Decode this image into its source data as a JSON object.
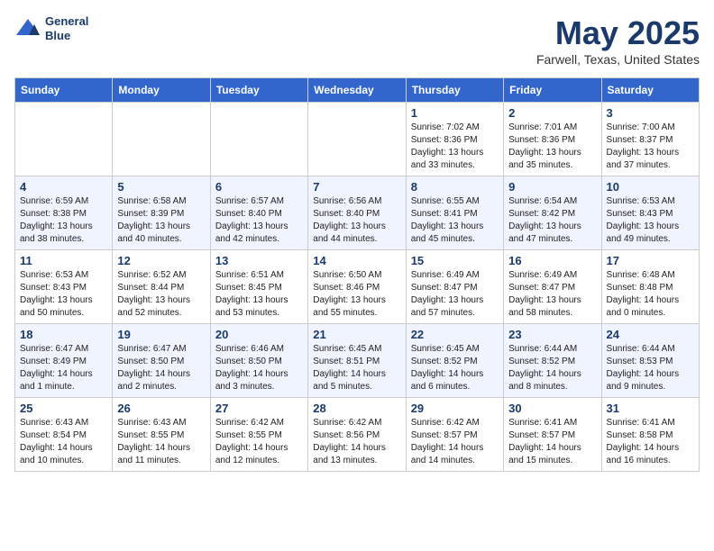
{
  "header": {
    "logo_line1": "General",
    "logo_line2": "Blue",
    "month": "May 2025",
    "location": "Farwell, Texas, United States"
  },
  "weekdays": [
    "Sunday",
    "Monday",
    "Tuesday",
    "Wednesday",
    "Thursday",
    "Friday",
    "Saturday"
  ],
  "weeks": [
    [
      {
        "day": "",
        "info": ""
      },
      {
        "day": "",
        "info": ""
      },
      {
        "day": "",
        "info": ""
      },
      {
        "day": "",
        "info": ""
      },
      {
        "day": "1",
        "info": "Sunrise: 7:02 AM\nSunset: 8:36 PM\nDaylight: 13 hours\nand 33 minutes."
      },
      {
        "day": "2",
        "info": "Sunrise: 7:01 AM\nSunset: 8:36 PM\nDaylight: 13 hours\nand 35 minutes."
      },
      {
        "day": "3",
        "info": "Sunrise: 7:00 AM\nSunset: 8:37 PM\nDaylight: 13 hours\nand 37 minutes."
      }
    ],
    [
      {
        "day": "4",
        "info": "Sunrise: 6:59 AM\nSunset: 8:38 PM\nDaylight: 13 hours\nand 38 minutes."
      },
      {
        "day": "5",
        "info": "Sunrise: 6:58 AM\nSunset: 8:39 PM\nDaylight: 13 hours\nand 40 minutes."
      },
      {
        "day": "6",
        "info": "Sunrise: 6:57 AM\nSunset: 8:40 PM\nDaylight: 13 hours\nand 42 minutes."
      },
      {
        "day": "7",
        "info": "Sunrise: 6:56 AM\nSunset: 8:40 PM\nDaylight: 13 hours\nand 44 minutes."
      },
      {
        "day": "8",
        "info": "Sunrise: 6:55 AM\nSunset: 8:41 PM\nDaylight: 13 hours\nand 45 minutes."
      },
      {
        "day": "9",
        "info": "Sunrise: 6:54 AM\nSunset: 8:42 PM\nDaylight: 13 hours\nand 47 minutes."
      },
      {
        "day": "10",
        "info": "Sunrise: 6:53 AM\nSunset: 8:43 PM\nDaylight: 13 hours\nand 49 minutes."
      }
    ],
    [
      {
        "day": "11",
        "info": "Sunrise: 6:53 AM\nSunset: 8:43 PM\nDaylight: 13 hours\nand 50 minutes."
      },
      {
        "day": "12",
        "info": "Sunrise: 6:52 AM\nSunset: 8:44 PM\nDaylight: 13 hours\nand 52 minutes."
      },
      {
        "day": "13",
        "info": "Sunrise: 6:51 AM\nSunset: 8:45 PM\nDaylight: 13 hours\nand 53 minutes."
      },
      {
        "day": "14",
        "info": "Sunrise: 6:50 AM\nSunset: 8:46 PM\nDaylight: 13 hours\nand 55 minutes."
      },
      {
        "day": "15",
        "info": "Sunrise: 6:49 AM\nSunset: 8:47 PM\nDaylight: 13 hours\nand 57 minutes."
      },
      {
        "day": "16",
        "info": "Sunrise: 6:49 AM\nSunset: 8:47 PM\nDaylight: 13 hours\nand 58 minutes."
      },
      {
        "day": "17",
        "info": "Sunrise: 6:48 AM\nSunset: 8:48 PM\nDaylight: 14 hours\nand 0 minutes."
      }
    ],
    [
      {
        "day": "18",
        "info": "Sunrise: 6:47 AM\nSunset: 8:49 PM\nDaylight: 14 hours\nand 1 minute."
      },
      {
        "day": "19",
        "info": "Sunrise: 6:47 AM\nSunset: 8:50 PM\nDaylight: 14 hours\nand 2 minutes."
      },
      {
        "day": "20",
        "info": "Sunrise: 6:46 AM\nSunset: 8:50 PM\nDaylight: 14 hours\nand 3 minutes."
      },
      {
        "day": "21",
        "info": "Sunrise: 6:45 AM\nSunset: 8:51 PM\nDaylight: 14 hours\nand 5 minutes."
      },
      {
        "day": "22",
        "info": "Sunrise: 6:45 AM\nSunset: 8:52 PM\nDaylight: 14 hours\nand 6 minutes."
      },
      {
        "day": "23",
        "info": "Sunrise: 6:44 AM\nSunset: 8:52 PM\nDaylight: 14 hours\nand 8 minutes."
      },
      {
        "day": "24",
        "info": "Sunrise: 6:44 AM\nSunset: 8:53 PM\nDaylight: 14 hours\nand 9 minutes."
      }
    ],
    [
      {
        "day": "25",
        "info": "Sunrise: 6:43 AM\nSunset: 8:54 PM\nDaylight: 14 hours\nand 10 minutes."
      },
      {
        "day": "26",
        "info": "Sunrise: 6:43 AM\nSunset: 8:55 PM\nDaylight: 14 hours\nand 11 minutes."
      },
      {
        "day": "27",
        "info": "Sunrise: 6:42 AM\nSunset: 8:55 PM\nDaylight: 14 hours\nand 12 minutes."
      },
      {
        "day": "28",
        "info": "Sunrise: 6:42 AM\nSunset: 8:56 PM\nDaylight: 14 hours\nand 13 minutes."
      },
      {
        "day": "29",
        "info": "Sunrise: 6:42 AM\nSunset: 8:57 PM\nDaylight: 14 hours\nand 14 minutes."
      },
      {
        "day": "30",
        "info": "Sunrise: 6:41 AM\nSunset: 8:57 PM\nDaylight: 14 hours\nand 15 minutes."
      },
      {
        "day": "31",
        "info": "Sunrise: 6:41 AM\nSunset: 8:58 PM\nDaylight: 14 hours\nand 16 minutes."
      }
    ]
  ]
}
